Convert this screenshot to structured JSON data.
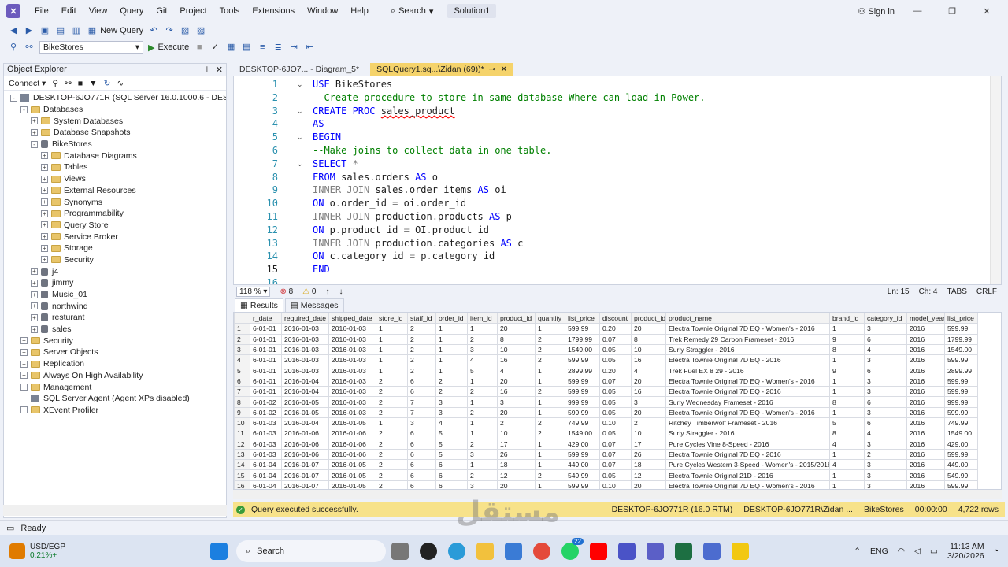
{
  "menubar": {
    "items": [
      "File",
      "Edit",
      "View",
      "Query",
      "Git",
      "Project",
      "Tools",
      "Extensions",
      "Window",
      "Help"
    ],
    "search_label": "Search",
    "solution": "Solution1",
    "sign_in": "Sign in"
  },
  "toolbar": {
    "new_query": "New Query",
    "database": "BikeStores",
    "execute": "Execute"
  },
  "object_explorer": {
    "title": "Object Explorer",
    "connect": "Connect",
    "tree": [
      {
        "level": 0,
        "label": "DESKTOP-6JO771R (SQL Server 16.0.1000.6 - DESKTOP-6JO",
        "exp": "-",
        "icon": "server"
      },
      {
        "level": 1,
        "label": "Databases",
        "exp": "-",
        "icon": "folder"
      },
      {
        "level": 2,
        "label": "System Databases",
        "exp": "+",
        "icon": "folder"
      },
      {
        "level": 2,
        "label": "Database Snapshots",
        "exp": "+",
        "icon": "folder"
      },
      {
        "level": 2,
        "label": "BikeStores",
        "exp": "-",
        "icon": "db"
      },
      {
        "level": 3,
        "label": "Database Diagrams",
        "exp": "+",
        "icon": "folder"
      },
      {
        "level": 3,
        "label": "Tables",
        "exp": "+",
        "icon": "folder"
      },
      {
        "level": 3,
        "label": "Views",
        "exp": "+",
        "icon": "folder"
      },
      {
        "level": 3,
        "label": "External Resources",
        "exp": "+",
        "icon": "folder"
      },
      {
        "level": 3,
        "label": "Synonyms",
        "exp": "+",
        "icon": "folder"
      },
      {
        "level": 3,
        "label": "Programmability",
        "exp": "+",
        "icon": "folder"
      },
      {
        "level": 3,
        "label": "Query Store",
        "exp": "+",
        "icon": "folder"
      },
      {
        "level": 3,
        "label": "Service Broker",
        "exp": "+",
        "icon": "folder"
      },
      {
        "level": 3,
        "label": "Storage",
        "exp": "+",
        "icon": "folder"
      },
      {
        "level": 3,
        "label": "Security",
        "exp": "+",
        "icon": "folder"
      },
      {
        "level": 2,
        "label": "j4",
        "exp": "+",
        "icon": "db"
      },
      {
        "level": 2,
        "label": "jimmy",
        "exp": "+",
        "icon": "db"
      },
      {
        "level": 2,
        "label": "Music_01",
        "exp": "+",
        "icon": "db"
      },
      {
        "level": 2,
        "label": "northwind",
        "exp": "+",
        "icon": "db"
      },
      {
        "level": 2,
        "label": "resturant",
        "exp": "+",
        "icon": "db"
      },
      {
        "level": 2,
        "label": "sales",
        "exp": "+",
        "icon": "db"
      },
      {
        "level": 1,
        "label": "Security",
        "exp": "+",
        "icon": "folder"
      },
      {
        "level": 1,
        "label": "Server Objects",
        "exp": "+",
        "icon": "folder"
      },
      {
        "level": 1,
        "label": "Replication",
        "exp": "+",
        "icon": "folder"
      },
      {
        "level": 1,
        "label": "Always On High Availability",
        "exp": "+",
        "icon": "folder"
      },
      {
        "level": 1,
        "label": "Management",
        "exp": "+",
        "icon": "folder"
      },
      {
        "level": 1,
        "label": "SQL Server Agent (Agent XPs disabled)",
        "exp": "",
        "icon": "agent"
      },
      {
        "level": 1,
        "label": "XEvent Profiler",
        "exp": "+",
        "icon": "folder"
      }
    ]
  },
  "tabs": [
    {
      "label": "DESKTOP-6JO7... - Diagram_5*",
      "active": false
    },
    {
      "label": "SQLQuery1.sq...\\Zidan (69))*",
      "active": true
    }
  ],
  "editor": {
    "lines": [
      {
        "n": "1",
        "fold": "v",
        "html": "<span class='kw'>USE</span> BikeStores"
      },
      {
        "n": "2",
        "fold": "",
        "html": "<span class='cm'>--Create procedure to store in same database Where can load in Power.</span>"
      },
      {
        "n": "3",
        "fold": "v",
        "html": "<span class='kw'>CREATE PROC</span> <span class='sq'>sales_product</span>"
      },
      {
        "n": "4",
        "fold": "",
        "html": "<span class='kw'>AS</span>"
      },
      {
        "n": "5",
        "fold": "v",
        "html": "<span class='kw'>BEGIN</span>"
      },
      {
        "n": "6",
        "fold": "",
        "html": "<span class='cm'>--Make joins to collect data in one table.</span>"
      },
      {
        "n": "7",
        "fold": "v",
        "html": "<span class='kw'>SELECT</span> <span class='gr'>*</span>"
      },
      {
        "n": "8",
        "fold": "",
        "html": "<span class='kw'>FROM</span> sales<span class='gr'>.</span>orders <span class='kw'>AS</span> o"
      },
      {
        "n": "9",
        "fold": "",
        "html": "<span class='gr'>INNER JOIN</span> sales<span class='gr'>.</span>order_items <span class='kw'>AS</span> oi"
      },
      {
        "n": "10",
        "fold": "",
        "html": "<span class='kw'>ON</span> o<span class='gr'>.</span>order_id <span class='gr'>=</span> oi<span class='gr'>.</span>order_id"
      },
      {
        "n": "11",
        "fold": "",
        "html": "<span class='gr'>INNER JOIN</span> production<span class='gr'>.</span>products <span class='kw'>AS</span> p"
      },
      {
        "n": "12",
        "fold": "",
        "html": "<span class='kw'>ON</span> p<span class='gr'>.</span>product_id <span class='gr'>=</span> OI<span class='gr'>.</span>product_id"
      },
      {
        "n": "13",
        "fold": "",
        "html": "<span class='gr'>INNER JOIN</span> production<span class='gr'>.</span>categories <span class='kw'>AS</span> c"
      },
      {
        "n": "14",
        "fold": "",
        "html": "<span class='kw'>ON</span> c<span class='gr'>.</span>category_id <span class='gr'>=</span> p<span class='gr'>.</span>category_id"
      },
      {
        "n": "15",
        "fold": "",
        "html": "<span class='kw'>END</span>"
      },
      {
        "n": "16",
        "fold": "",
        "html": ""
      }
    ]
  },
  "editor_status": {
    "zoom": "118 %",
    "errors": "8",
    "warnings": "0",
    "ln": "Ln: 15",
    "ch": "Ch: 4",
    "tabs": "TABS",
    "crlf": "CRLF"
  },
  "result_tabs": [
    "Results",
    "Messages"
  ],
  "grid": {
    "columns": [
      "",
      "r_date",
      "required_date",
      "shipped_date",
      "store_id",
      "staff_id",
      "order_id",
      "item_id",
      "product_id",
      "quantity",
      "list_price",
      "discount",
      "product_id",
      "product_name",
      "brand_id",
      "category_id",
      "model_year",
      "list_price"
    ],
    "widths": [
      20,
      40,
      60,
      60,
      40,
      36,
      40,
      38,
      48,
      38,
      44,
      40,
      44,
      208,
      44,
      54,
      48,
      42
    ],
    "rows": [
      [
        "1",
        "6-01-01",
        "2016-01-03",
        "2016-01-03",
        "1",
        "2",
        "1",
        "1",
        "20",
        "1",
        "599.99",
        "0.20",
        "20",
        "Electra Townie Original 7D EQ - Women's - 2016",
        "1",
        "3",
        "2016",
        "599.99"
      ],
      [
        "2",
        "6-01-01",
        "2016-01-03",
        "2016-01-03",
        "1",
        "2",
        "1",
        "2",
        "8",
        "2",
        "1799.99",
        "0.07",
        "8",
        "Trek Remedy 29 Carbon Frameset - 2016",
        "9",
        "6",
        "2016",
        "1799.99"
      ],
      [
        "3",
        "6-01-01",
        "2016-01-03",
        "2016-01-03",
        "1",
        "2",
        "1",
        "3",
        "10",
        "2",
        "1549.00",
        "0.05",
        "10",
        "Surly Straggler - 2016",
        "8",
        "4",
        "2016",
        "1549.00"
      ],
      [
        "4",
        "6-01-01",
        "2016-01-03",
        "2016-01-03",
        "1",
        "2",
        "1",
        "4",
        "16",
        "2",
        "599.99",
        "0.05",
        "16",
        "Electra Townie Original 7D EQ - 2016",
        "1",
        "3",
        "2016",
        "599.99"
      ],
      [
        "5",
        "6-01-01",
        "2016-01-03",
        "2016-01-03",
        "1",
        "2",
        "1",
        "5",
        "4",
        "1",
        "2899.99",
        "0.20",
        "4",
        "Trek Fuel EX 8 29 - 2016",
        "9",
        "6",
        "2016",
        "2899.99"
      ],
      [
        "6",
        "6-01-01",
        "2016-01-04",
        "2016-01-03",
        "2",
        "6",
        "2",
        "1",
        "20",
        "1",
        "599.99",
        "0.07",
        "20",
        "Electra Townie Original 7D EQ - Women's - 2016",
        "1",
        "3",
        "2016",
        "599.99"
      ],
      [
        "7",
        "6-01-01",
        "2016-01-04",
        "2016-01-03",
        "2",
        "6",
        "2",
        "2",
        "16",
        "2",
        "599.99",
        "0.05",
        "16",
        "Electra Townie Original 7D EQ - 2016",
        "1",
        "3",
        "2016",
        "599.99"
      ],
      [
        "8",
        "6-01-02",
        "2016-01-05",
        "2016-01-03",
        "2",
        "7",
        "3",
        "1",
        "3",
        "1",
        "999.99",
        "0.05",
        "3",
        "Surly Wednesday Frameset - 2016",
        "8",
        "6",
        "2016",
        "999.99"
      ],
      [
        "9",
        "6-01-02",
        "2016-01-05",
        "2016-01-03",
        "2",
        "7",
        "3",
        "2",
        "20",
        "1",
        "599.99",
        "0.05",
        "20",
        "Electra Townie Original 7D EQ - Women's - 2016",
        "1",
        "3",
        "2016",
        "599.99"
      ],
      [
        "10",
        "6-01-03",
        "2016-01-04",
        "2016-01-05",
        "1",
        "3",
        "4",
        "1",
        "2",
        "2",
        "749.99",
        "0.10",
        "2",
        "Ritchey Timberwolf Frameset - 2016",
        "5",
        "6",
        "2016",
        "749.99"
      ],
      [
        "11",
        "6-01-03",
        "2016-01-06",
        "2016-01-06",
        "2",
        "6",
        "5",
        "1",
        "10",
        "2",
        "1549.00",
        "0.05",
        "10",
        "Surly Straggler - 2016",
        "8",
        "4",
        "2016",
        "1549.00"
      ],
      [
        "12",
        "6-01-03",
        "2016-01-06",
        "2016-01-06",
        "2",
        "6",
        "5",
        "2",
        "17",
        "1",
        "429.00",
        "0.07",
        "17",
        "Pure Cycles Vine 8-Speed - 2016",
        "4",
        "3",
        "2016",
        "429.00"
      ],
      [
        "13",
        "6-01-03",
        "2016-01-06",
        "2016-01-06",
        "2",
        "6",
        "5",
        "3",
        "26",
        "1",
        "599.99",
        "0.07",
        "26",
        "Electra Townie Original 7D EQ - 2016",
        "1",
        "2",
        "2016",
        "599.99"
      ],
      [
        "14",
        "6-01-04",
        "2016-01-07",
        "2016-01-05",
        "2",
        "6",
        "6",
        "1",
        "18",
        "1",
        "449.00",
        "0.07",
        "18",
        "Pure Cycles Western 3-Speed - Women's - 2015/2016",
        "4",
        "3",
        "2016",
        "449.00"
      ],
      [
        "15",
        "6-01-04",
        "2016-01-07",
        "2016-01-05",
        "2",
        "6",
        "6",
        "2",
        "12",
        "2",
        "549.99",
        "0.05",
        "12",
        "Electra Townie Original 21D - 2016",
        "1",
        "3",
        "2016",
        "549.99"
      ],
      [
        "16",
        "6-01-04",
        "2016-01-07",
        "2016-01-05",
        "2",
        "6",
        "6",
        "3",
        "20",
        "1",
        "599.99",
        "0.10",
        "20",
        "Electra Townie Original 7D EQ - Women's - 2016",
        "1",
        "3",
        "2016",
        "599.99"
      ]
    ]
  },
  "query_status": {
    "message": "Query executed successfully.",
    "server": "DESKTOP-6JO771R (16.0 RTM)",
    "user": "DESKTOP-6JO771R\\Zidan ...",
    "db": "BikeStores",
    "time": "00:00:00",
    "rows": "4,722 rows"
  },
  "status_bar": {
    "ready": "Ready"
  },
  "taskbar": {
    "ticker": "USD/EGP",
    "change": "0.21%+",
    "search": "Search",
    "lang": "ENG",
    "time": "11:13 AM",
    "date": "3/20/2026",
    "badge": "22"
  },
  "watermark": "مستقل"
}
